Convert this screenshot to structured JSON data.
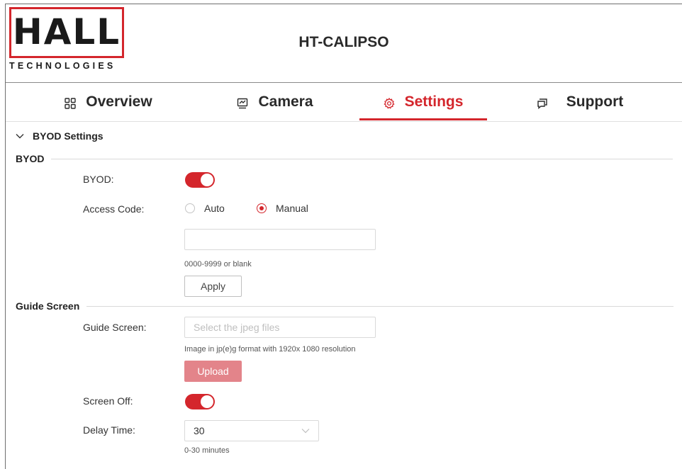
{
  "brand": {
    "logo_text": "HALL",
    "logo_sub": "TECHNOLOGIES",
    "accent_color": "#d4262c"
  },
  "header": {
    "title": "HT-CALIPSO"
  },
  "tabs": [
    {
      "label": "Overview",
      "icon": "grid-icon",
      "active": false
    },
    {
      "label": "Camera",
      "icon": "camera-monitor-icon",
      "active": false
    },
    {
      "label": "Settings",
      "icon": "gear-icon",
      "active": true
    },
    {
      "label": "Support",
      "icon": "chat-icon",
      "active": false
    }
  ],
  "panel": {
    "title": "BYOD Settings",
    "collapse_icon": "chevron-down-icon"
  },
  "byod": {
    "section_title": "BYOD",
    "byod_label": "BYOD:",
    "byod_enabled": true,
    "access_code_label": "Access Code:",
    "options": [
      {
        "label": "Auto",
        "checked": false
      },
      {
        "label": "Manual",
        "checked": true
      }
    ],
    "code_value": "",
    "code_hint": "0000-9999 or blank",
    "apply_label": "Apply"
  },
  "guide": {
    "section_title": "Guide Screen",
    "guide_label": "Guide Screen:",
    "file_placeholder": "Select the jpeg files",
    "file_hint": "Image in jp(e)g format with 1920x 1080 resolution",
    "upload_label": "Upload",
    "screen_off_label": "Screen Off:",
    "screen_off_enabled": true,
    "delay_label": "Delay Time:",
    "delay_value": "30",
    "delay_hint": "0-30 minutes"
  }
}
